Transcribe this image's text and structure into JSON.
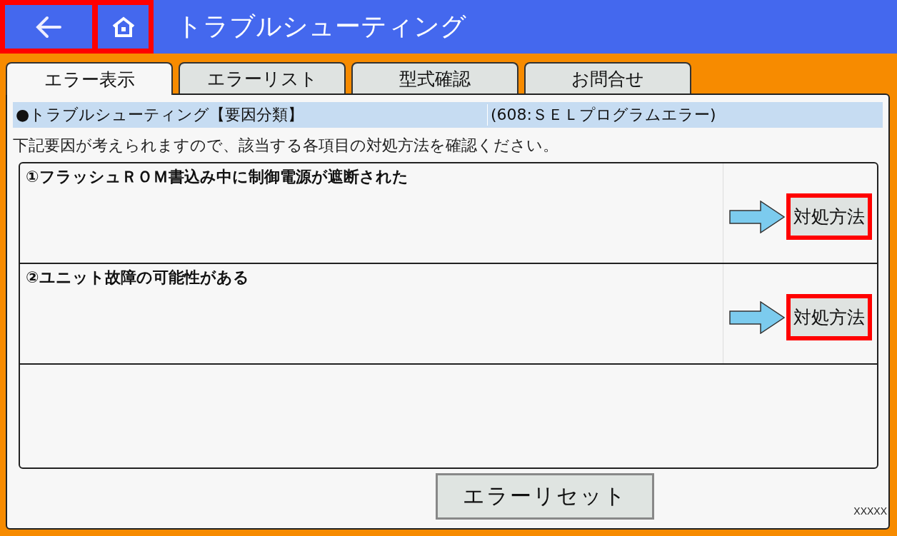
{
  "header": {
    "back_button": {
      "highlighted": true
    },
    "home_button": {
      "highlighted": true
    },
    "title": "トラブルシューティング"
  },
  "tabs": [
    {
      "label": "エラー表示",
      "selected": true
    },
    {
      "label": "エラーリスト",
      "selected": false
    },
    {
      "label": "型式確認",
      "selected": false
    },
    {
      "label": "お問合せ",
      "selected": false
    }
  ],
  "info_bar": {
    "heading": "●トラブルシューティング【要因分類】",
    "error": "(608:ＳＥＬプログラムエラー)"
  },
  "instruction": "下記要因が考えられますので、該当する各項目の対処方法を確認ください。",
  "causes": [
    {
      "text": "①フラッシュＲＯＭ書込み中に制御電源が遮断された",
      "action": "対処方法",
      "highlighted": true
    },
    {
      "text": "②ユニット故障の可能性がある",
      "action": "対処方法",
      "highlighted": true
    }
  ],
  "reset_button": "エラーリセット",
  "footer_code": "XXXXX"
}
